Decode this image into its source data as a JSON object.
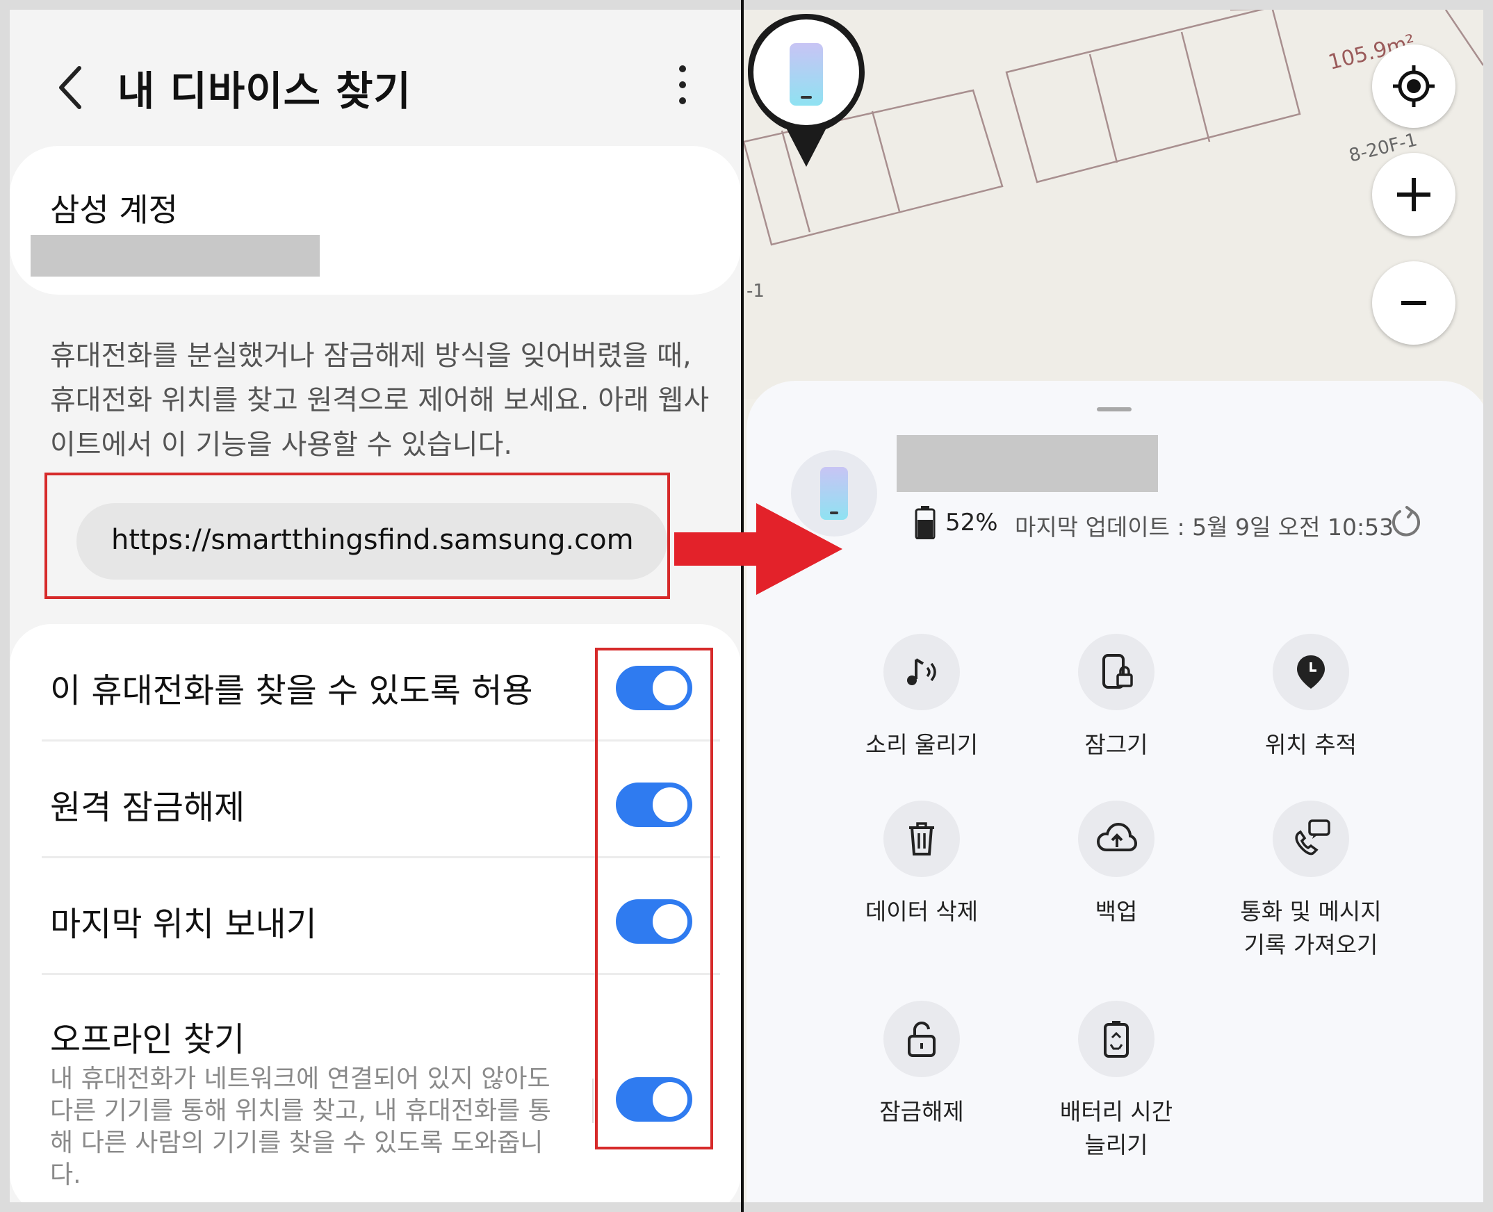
{
  "left_panel": {
    "title": "내 디바이스 찾기",
    "account_section_title": "삼성 계정",
    "description": "휴대전화를 분실했거나 잠금해제 방식을 잊어버렸을 때, 휴대전화 위치를 찾고 원격으로 제어해 보세요. 아래 웹사이트에서 이 기능을 사용할 수 있습니다.",
    "url": "https://smartthingsfind.samsung.com",
    "settings": [
      {
        "label": "이 휴대전화를 찾을 수 있도록 허용",
        "enabled": true
      },
      {
        "label": "원격 잠금해제",
        "enabled": true
      },
      {
        "label": "마지막 위치 보내기",
        "enabled": true
      },
      {
        "label": "오프라인 찾기",
        "sublabel": "내 휴대전화가 네트워크에 연결되어 있지 않아도 다른 기기를 통해 위치를 찾고, 내 휴대전화를 통해 다른 사람의 기기를 찾을 수 있도록 도와줍니다.",
        "enabled": true
      }
    ],
    "accent_color": "#2f7bf0",
    "highlight_color": "#d62a2a"
  },
  "map": {
    "area_label": "105.9m²",
    "unit_label": "8-20F-1",
    "edge_label": "-1"
  },
  "device_sheet": {
    "battery": "52%",
    "last_update": "마지막 업데이트 : 5월 9일 오전 10:53",
    "actions": [
      {
        "label": "소리 울리기",
        "icon": "music-note-icon"
      },
      {
        "label": "잠그기",
        "icon": "phone-lock-icon"
      },
      {
        "label": "위치 추적",
        "icon": "location-clock-icon"
      },
      {
        "label": "데이터 삭제",
        "icon": "trash-icon"
      },
      {
        "label": "백업",
        "icon": "cloud-upload-icon"
      },
      {
        "label": "통화 및 메시지\n기록 가져오기",
        "icon": "call-message-icon"
      },
      {
        "label": "잠금해제",
        "icon": "unlock-icon"
      },
      {
        "label": "배터리 시간\n늘리기",
        "icon": "battery-recycle-icon"
      }
    ]
  }
}
